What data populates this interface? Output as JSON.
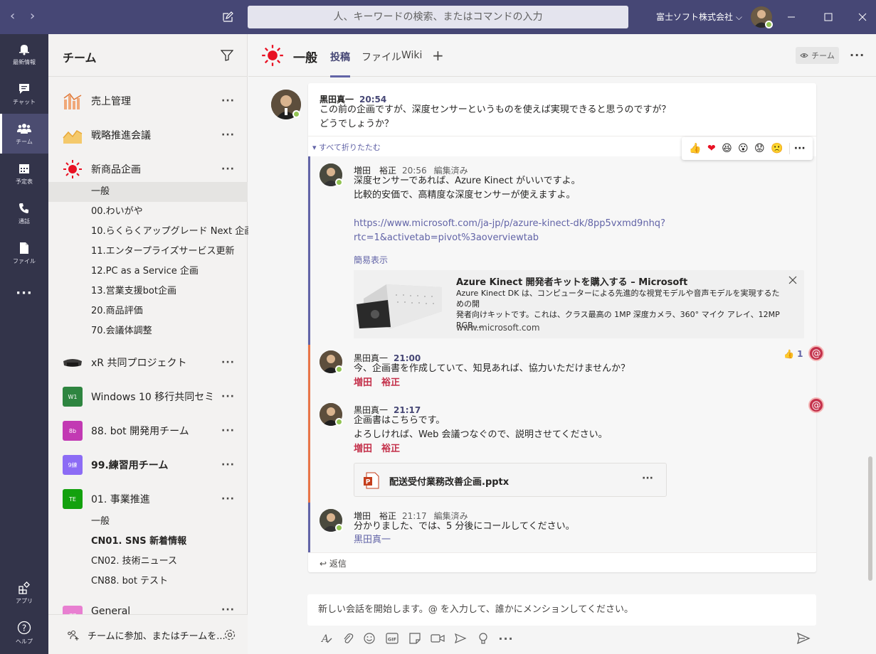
{
  "titlebar": {
    "search_placeholder": "人、キーワードの検索、またはコマンドの入力",
    "org": "富士ソフト株式会社 ⌵"
  },
  "rail": {
    "items": [
      {
        "label": "最新情報",
        "icon": "bell-icon"
      },
      {
        "label": "チャット",
        "icon": "chat-icon"
      },
      {
        "label": "チーム",
        "icon": "teams-icon"
      },
      {
        "label": "予定表",
        "icon": "calendar-icon"
      },
      {
        "label": "通話",
        "icon": "phone-icon"
      },
      {
        "label": "ファイル",
        "icon": "file-icon"
      },
      {
        "label": "アプリ",
        "icon": "apps-icon"
      },
      {
        "label": "ヘルプ",
        "icon": "help-icon"
      }
    ]
  },
  "panel": {
    "title": "チーム",
    "teams": [
      {
        "name": "売上管理",
        "logo": "chart-bars"
      },
      {
        "name": "戦略推進会議",
        "logo": "chart-area"
      },
      {
        "name": "新商品企画",
        "logo": "sun"
      },
      {
        "name": "xR 共同プロジェクト",
        "logo": "headset"
      },
      {
        "name": "Windows 10 移行共同セミ...",
        "logo_text": "W1",
        "color": "#2e8540"
      },
      {
        "name": "88. bot 開発用チーム",
        "logo_text": "8b",
        "color": "#c239b3"
      },
      {
        "name": "99.練習用チーム",
        "logo_text": "9練",
        "color": "#8c6cf5"
      },
      {
        "name": "01. 事業推進",
        "logo_text": "TE",
        "color": "#13a10e"
      },
      {
        "name": "General",
        "logo_text": "GE",
        "color": "#e87fd1"
      }
    ],
    "channels_new_product": [
      "一般",
      "00.わいがや",
      "10.らくらくアップグレード Next 企画",
      "11.エンタープライズサービス更新",
      "12.PC as a Service 企画",
      "13.営業支援bot企画",
      "20.商品評価",
      "70.会議体調整"
    ],
    "channels_business": [
      "一般",
      "CN01. SNS 新着情報",
      "CN02. 技術ニュース",
      "CN88. bot テスト"
    ],
    "footer": "チームに参加、またはチームを..."
  },
  "channel": {
    "name": "一般",
    "tabs": [
      "投稿",
      "ファイル",
      "Wiki"
    ],
    "team_button": "チーム"
  },
  "thread": {
    "root": {
      "author": "黒田真一",
      "time": "20:54",
      "lines": [
        "この前の企画ですが、深度センサーというものを使えば実現できると思うのですが？",
        "どうでしょうか？"
      ]
    },
    "collapse_label": "すべて折りたたむ",
    "replies": [
      {
        "author": "増田　裕正",
        "time": "20:56",
        "edited": "編集済み",
        "lines": [
          "深度センサーであれば、Azure Kinect がいいですよ。",
          "比較的安価で、高精度な深度センサーが使えますよ。"
        ],
        "link_lines": [
          "https://www.microsoft.com/ja-jp/p/azure-kinect-dk/8pp5vxmd9nhq?",
          "rtc=1&activetab=pivot%3aoverviewtab"
        ],
        "simple_view": "簡易表示",
        "preview": {
          "title": "Azure Kinect 開発者キットを購入する – Microsoft",
          "desc_lines": [
            "Azure Kinect DK は、コンピューターによる先進的な視覚モデルや音声モデルを実現するための開",
            "発者向けキットです。これは、クラス最高の 1MP 深度カメラ、360° マイク アレイ、12MP RGB ..."
          ],
          "domain": "www.microsoft.com"
        }
      },
      {
        "author": "黒田真一",
        "time": "21:00",
        "lines": [
          "今、企画書を作成していて、知見あれば、協力いただけませんか？"
        ],
        "mention": "増田　裕正",
        "like_count": "1"
      },
      {
        "author": "黒田真一",
        "time": "21:17",
        "lines": [
          "企画書はこちらです。",
          "よろしければ、Web 会議つなぐので、説明させてください。"
        ],
        "mention": "増田　裕正",
        "file": "配送受付業務改善企画.pptx"
      },
      {
        "author": "増田　裕正",
        "time": "21:17",
        "edited": "編集済み",
        "lines": [
          "分かりました、では、5 分後にコールしてください。"
        ],
        "mention": "黒田真一"
      }
    ],
    "reply_label": "返信"
  },
  "compose": {
    "placeholder": "新しい会話を開始します。@ を入力して、誰かにメンションしてください。"
  }
}
